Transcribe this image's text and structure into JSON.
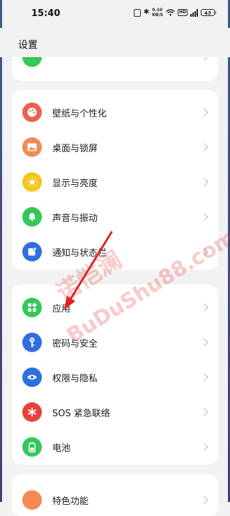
{
  "status_bar": {
    "time": "15:40",
    "speed_value": "0.10",
    "speed_unit": "KB/S",
    "hd": "HD",
    "network": "5G",
    "battery": "43"
  },
  "page_title": "设置",
  "card_top_partial_label": "",
  "group_1": [
    {
      "label": "壁纸与个性化",
      "icon": "palette-icon",
      "color": "#e8644a"
    },
    {
      "label": "桌面与锁屏",
      "icon": "image-icon",
      "color": "#f28a52"
    },
    {
      "label": "显示与亮度",
      "icon": "sun-icon",
      "color": "#f5c518"
    },
    {
      "label": "声音与振动",
      "icon": "bell-icon",
      "color": "#34c759"
    },
    {
      "label": "通知与状态栏",
      "icon": "notification-icon",
      "color": "#2f6fdf"
    }
  ],
  "group_2": [
    {
      "label": "应用",
      "icon": "apps-icon",
      "color": "#34c759"
    },
    {
      "label": "密码与安全",
      "icon": "key-icon",
      "color": "#2f6fdf"
    },
    {
      "label": "权限与隐私",
      "icon": "eye-shield-icon",
      "color": "#2f6fdf"
    },
    {
      "label": "SOS 紧急联络",
      "icon": "asterisk-icon",
      "color": "#e8403a"
    },
    {
      "label": "电池",
      "icon": "battery-icon",
      "color": "#34c759"
    }
  ],
  "group_3_partial_label": "特色功能",
  "watermark": [
    "诺恺澜",
    "BuDuShu88.com"
  ],
  "colors": {
    "background": "#f2f2f2",
    "card": "#ffffff",
    "arrow": "#e02020"
  }
}
